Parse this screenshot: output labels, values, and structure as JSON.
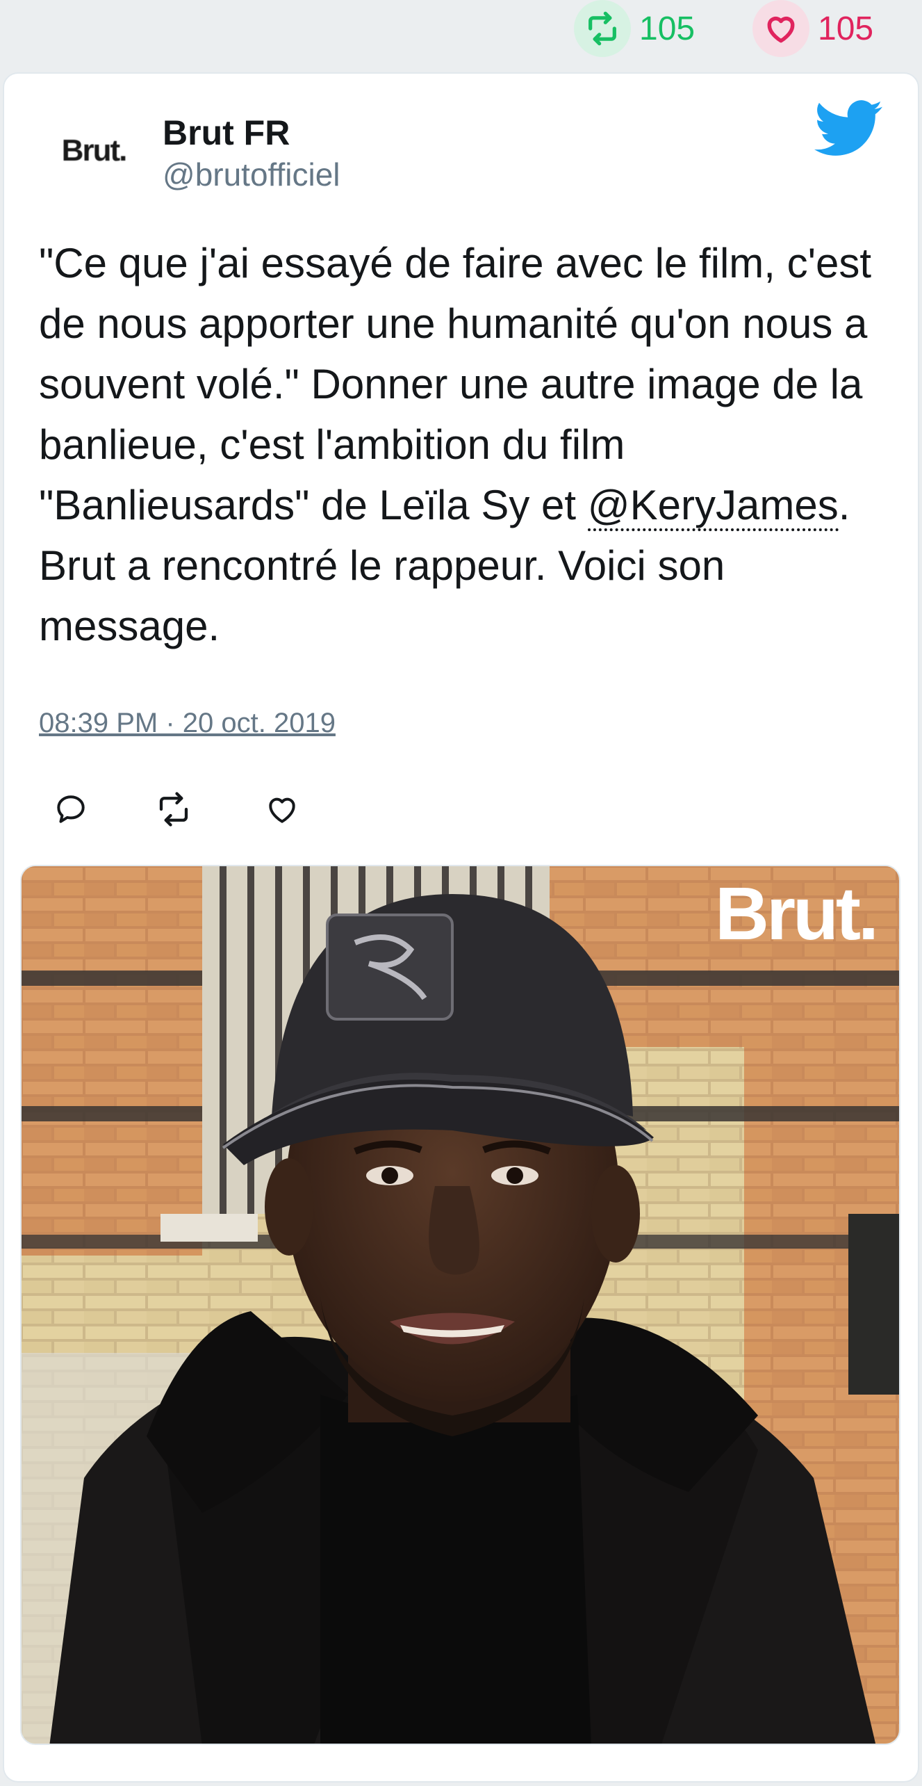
{
  "stats": {
    "retweets": "105",
    "likes": "105"
  },
  "author": {
    "avatar_text": "Brut.",
    "display_name": "Brut FR",
    "handle": "@brutofficiel"
  },
  "tweet": {
    "text_before": "\"Ce que j'ai essayé de faire avec le film, c'est de nous apporter une humanité qu'on nous a souvent volé.\" Donner une autre image de la banlieue, c'est l'ambition du film \"Banlieusards\" de Leïla Sy et ",
    "mention": "@KeryJames",
    "text_after": ". Brut a rencontré le rappeur. Voici son message.",
    "timestamp": "08:39 PM · 20 oct. 2019"
  },
  "media": {
    "watermark": "Brut."
  },
  "icons": {
    "retweet": "retweet-icon",
    "like": "heart-icon",
    "reply": "reply-icon",
    "bird": "twitter-bird-icon"
  },
  "colors": {
    "retweet_green": "#17bf63",
    "like_red": "#e0245e",
    "twitter_blue": "#1da1f2",
    "muted": "#657786"
  }
}
